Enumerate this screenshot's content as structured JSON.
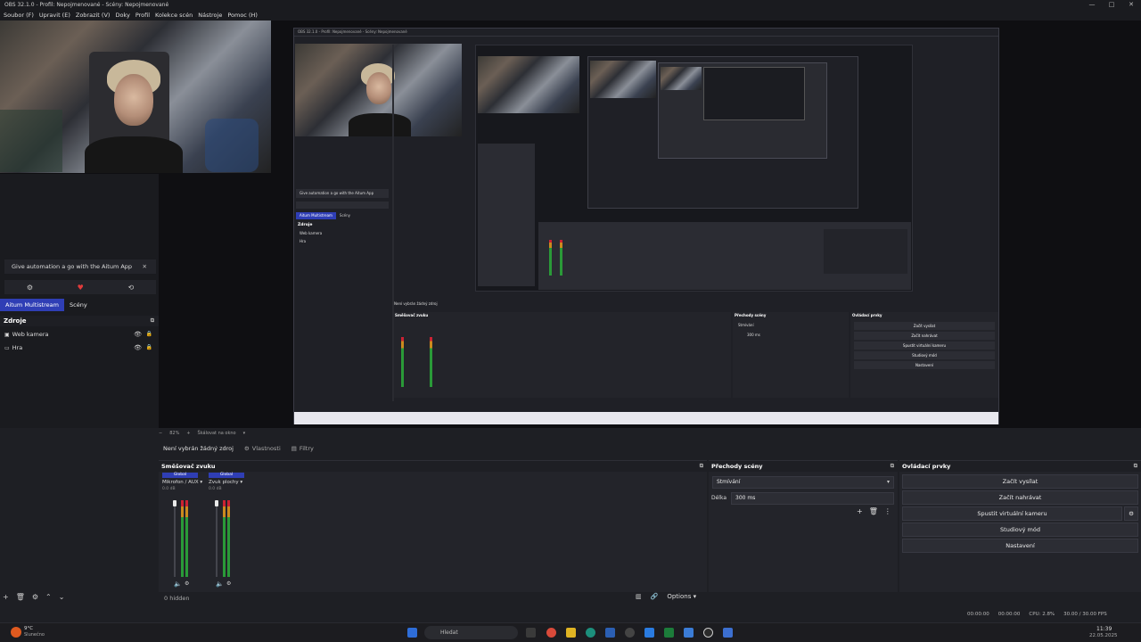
{
  "window": {
    "title": "OBS 32.1.0 - Profil: Nepojmenované - Scény: Nepojmenované",
    "controls": [
      "—",
      "□",
      "✕"
    ]
  },
  "menu": [
    "Soubor (F)",
    "Upravit (E)",
    "Zobrazit (V)",
    "Doky",
    "Profil",
    "Kolekce scén",
    "Nástroje",
    "Pomoc (H)"
  ],
  "left": {
    "automation_message": "Give automation a go with the Aitum App",
    "close": "✕",
    "tabs": [
      "Aitum Multistream",
      "Scény"
    ],
    "sources_header": "Zdroje",
    "sources": [
      {
        "name": "Web kamera"
      },
      {
        "name": "Hra"
      }
    ]
  },
  "zoom_bar": {
    "zoom": "82%",
    "label": "Škálovat na okno"
  },
  "context_bar": {
    "no_source": "Není vybrán žádný zdroj",
    "properties": "Vlastnosti",
    "filters": "Filtry"
  },
  "mixer": {
    "title": "Směšovač zvuku",
    "channels": [
      {
        "badge": "Global",
        "name": "Mikrofon / AUX",
        "db": "0.0 dB"
      },
      {
        "badge": "Global",
        "name": "Zvuk plochy",
        "db": "0.0 dB"
      }
    ],
    "hidden": "0 hidden",
    "options": "Options"
  },
  "transitions": {
    "title": "Přechody scény",
    "selected": "Stmívání",
    "duration_label": "Délka",
    "duration_value": "300 ms"
  },
  "controls": {
    "title": "Ovládací prvky",
    "buttons": [
      "Začít vysílat",
      "Začít nahrávat",
      "Spustit virtuální kameru",
      "Studiový mód",
      "Nastavení"
    ]
  },
  "status": {
    "stream_time": "00:00:00",
    "rec_time": "00:00:00",
    "cpu": "CPU: 2.8%",
    "fps": "30.00 / 30.00 FPS"
  },
  "taskbar": {
    "weather_temp": "9°C",
    "weather_desc": "Slunečno",
    "search": "Hledat",
    "time": "11:39",
    "date": "22.05.2025"
  },
  "inner_window": {
    "title": "OBS 32.1.0 - Profil: Nepojmenované - Scény: Nepojmenované",
    "automation_message": "Give automation a go with the Aitum App",
    "tabs": [
      "Aitum Multistream",
      "Scény"
    ],
    "sources_header": "Zdroje",
    "sources": [
      "Web kamera",
      "Hra"
    ],
    "no_source": "Není vybrán žádný zdroj",
    "mixer_title": "Směšovač zvuku",
    "transitions_title": "Přechody scény",
    "controls_title": "Ovládací prvky",
    "transition_selected": "Stmívání",
    "duration": "300 ms",
    "buttons": [
      "Začít vysílat",
      "Začít nahrávat",
      "Spustit virtuální kameru",
      "Studiový mód",
      "Nastavení"
    ]
  }
}
